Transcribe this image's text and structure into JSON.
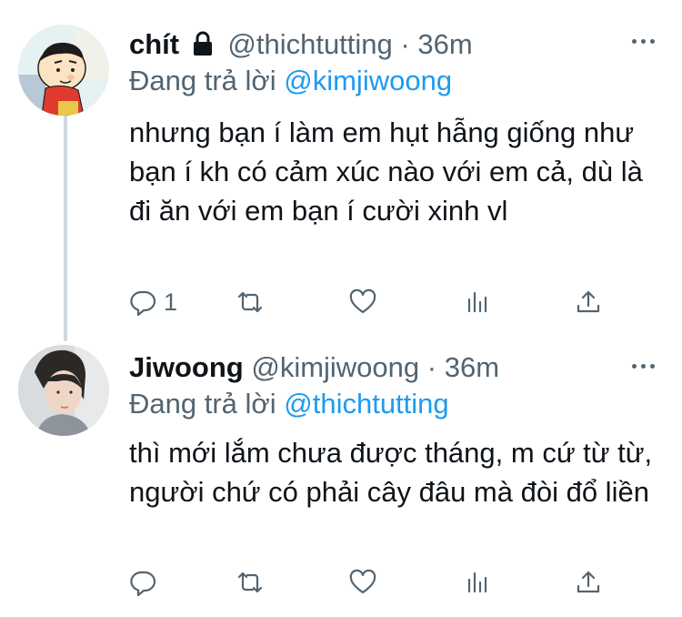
{
  "tweets": [
    {
      "display_name": "chít",
      "locked_icon": "lock-icon",
      "handle": "@thichtutting",
      "separator": "·",
      "time": "36m",
      "replying_prefix": "Đang trả lời",
      "replying_to": "@kimjiwoong",
      "text": "nhưng bạn í làm em hụt hẫng giống như bạn í kh có cảm xúc nào với em cả, dù là đi ăn với em bạn í cười xinh vl",
      "reply_count": "1",
      "retweet_count": "",
      "like_count": ""
    },
    {
      "display_name": "Jiwoong",
      "handle": "@kimjiwoong",
      "separator": "·",
      "time": "36m",
      "replying_prefix": "Đang trả lời",
      "replying_to": "@thichtutting",
      "text": "thì mới lắm chưa được tháng, m cứ từ từ, người chứ có phải cây đâu mà đòi đổ liền",
      "reply_count": "",
      "retweet_count": "",
      "like_count": ""
    }
  ],
  "icons": {
    "reply": "reply-icon",
    "retweet": "retweet-icon",
    "like": "heart-icon",
    "analytics": "analytics-icon",
    "share": "share-icon",
    "more": "more-icon"
  },
  "colors": {
    "accent": "#1d9bf0",
    "muted": "#536471",
    "text": "#0f1419"
  }
}
